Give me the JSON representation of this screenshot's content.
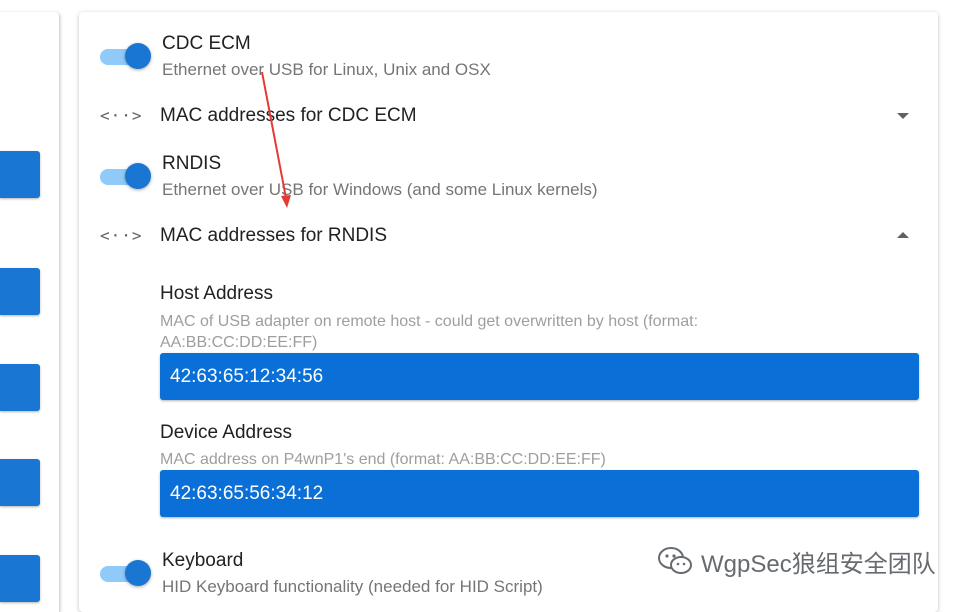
{
  "settings": {
    "cdc_ecm": {
      "title": "CDC ECM",
      "description": "Ethernet over USB for Linux, Unix and OSX",
      "enabled": true
    },
    "mac_cdc_ecm": {
      "label": "MAC addresses for CDC ECM",
      "expanded": false,
      "icon": "code-icon"
    },
    "rndis": {
      "title": "RNDIS",
      "description": "Ethernet over USB for Windows (and some Linux kernels)",
      "enabled": true
    },
    "mac_rndis": {
      "label": "MAC addresses for RNDIS",
      "expanded": true,
      "icon": "code-icon",
      "host": {
        "label": "Host Address",
        "hint_line1": "MAC of USB adapter on remote host - could get overwritten by host (format:",
        "hint_line2": "AA:BB:CC:DD:EE:FF)",
        "value": "42:63:65:12:34:56"
      },
      "device": {
        "label": "Device Address",
        "hint": "MAC address on P4wnP1's end (format: AA:BB:CC:DD:EE:FF)",
        "value": "42:63:65:56:34:12"
      }
    },
    "keyboard": {
      "title": "Keyboard",
      "description": "HID Keyboard functionality (needed for HID Script)",
      "enabled": true
    }
  },
  "watermark": {
    "text": "WgpSec狼组安全团队"
  },
  "colors": {
    "accent": "#1976d2",
    "toggle_track": "#90caf9",
    "annotation_arrow": "#e53935"
  }
}
